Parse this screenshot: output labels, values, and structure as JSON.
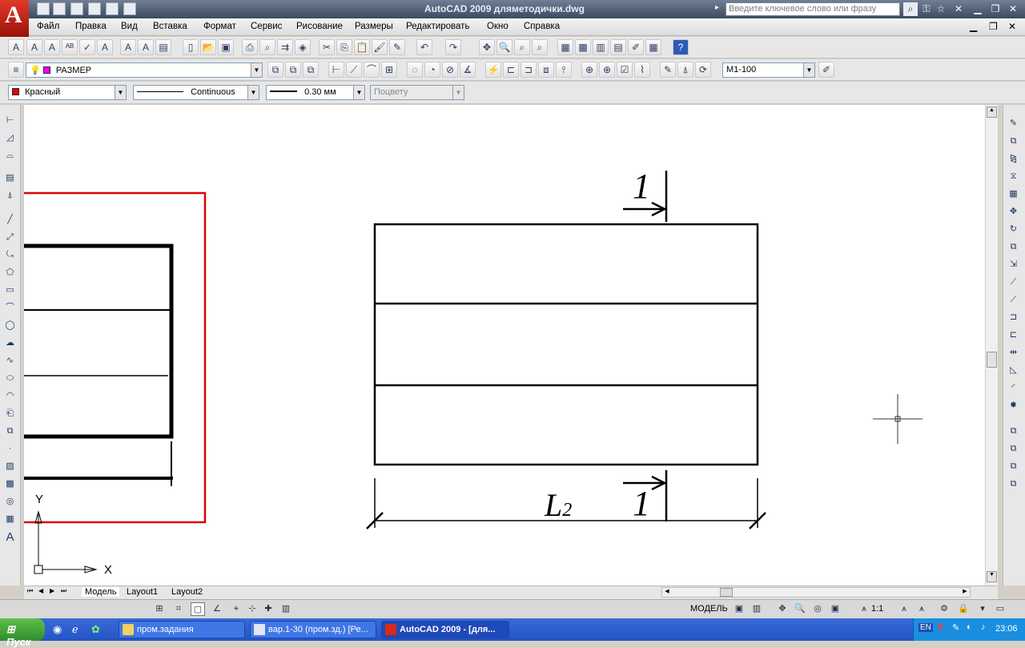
{
  "window": {
    "title": "AutoCAD 2009 дляметодички.dwg",
    "search_placeholder": "Введите ключевое слово или фразу"
  },
  "menu": [
    "Файл",
    "Правка",
    "Вид",
    "Вставка",
    "Формат",
    "Сервис",
    "Рисование",
    "Размеры",
    "Редактировать",
    "Окно",
    "Справка"
  ],
  "layers": {
    "current_layer": "РАЗМЕР",
    "dim_style": "М1-100"
  },
  "properties": {
    "color": "Красный",
    "color_hex": "#ee0000",
    "linetype": "Continuous",
    "lineweight": "0.30 мм",
    "plotstyle": "Поцвету"
  },
  "drawing": {
    "section_mark_top": "1",
    "section_mark_bottom": "1",
    "dimension_label": "L",
    "dimension_subscript": "2",
    "ucs_y": "Y",
    "ucs_x": "X"
  },
  "tabs": [
    "Модель",
    "Layout1",
    "Layout2"
  ],
  "status": {
    "space": "МОДЕЛЬ",
    "scale": "1:1"
  },
  "taskbar": {
    "start": "Пуск",
    "tasks": [
      "пром.задания",
      "вар.1-30 (пром.зд.) [Ре...",
      "AutoCAD 2009 - [для..."
    ],
    "lang": "EN",
    "clock": "23:06"
  }
}
